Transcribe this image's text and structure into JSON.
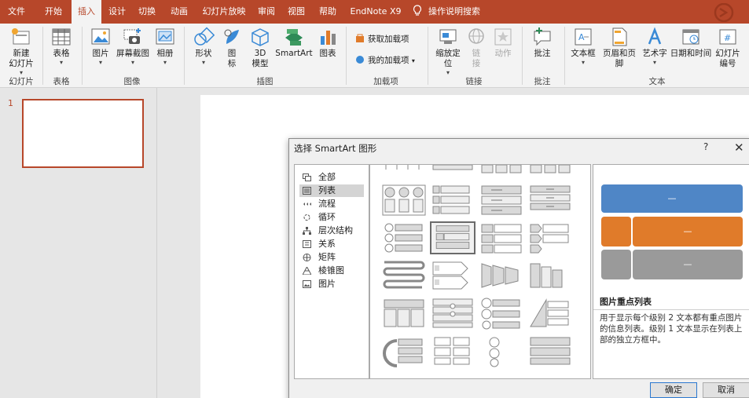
{
  "tabs": [
    "文件",
    "开始",
    "插入",
    "设计",
    "切换",
    "动画",
    "幻灯片放映",
    "审阅",
    "视图",
    "帮助",
    "EndNote X9"
  ],
  "active_tab": "插入",
  "search_label": "操作说明搜索",
  "ribbon": {
    "new_slide": "新建",
    "new_slide_2": "幻灯片",
    "table": "表格",
    "picture": "图片",
    "screenshot": "屏幕截图",
    "album": "相册",
    "shapes": "形状",
    "icons": "图",
    "icons_2": "标",
    "model3d": "3D",
    "model3d_2": "模型",
    "smartart": "SmartArt",
    "chart": "图表",
    "get_addins": "获取加载项",
    "my_addins": "我的加载项",
    "zoom": "缩放定",
    "zoom_2": "位",
    "link": "链",
    "link_2": "接",
    "action": "动作",
    "comment": "批注",
    "textbox": "文本框",
    "header_footer": "页眉和页脚",
    "wordart": "艺术字",
    "datetime": "日期和时间",
    "slide_number": "幻灯片",
    "slide_number_2": "编号"
  },
  "groups": {
    "slides": "幻灯片",
    "tables": "表格",
    "images": "图像",
    "illustrations": "插图",
    "addins": "加载项",
    "links": "链接",
    "comments": "批注",
    "text": "文本"
  },
  "slide_number": "1",
  "dialog": {
    "title": "选择 SmartArt 图形",
    "help": "?",
    "close": "✕",
    "categories": [
      "全部",
      "列表",
      "流程",
      "循环",
      "层次结构",
      "关系",
      "矩阵",
      "棱锥图",
      "图片"
    ],
    "selected_category": "列表",
    "preview_bar_label": "—",
    "preview_title": "图片重点列表",
    "preview_desc": "用于显示每个级别 2 文本都有重点图片的信息列表。级别 1 文本显示在列表上部的独立方框中。",
    "ok": "确定",
    "cancel": "取消"
  },
  "colors": {
    "accent": "#b7472a",
    "blue": "#4f86c6",
    "orange": "#e07b2a",
    "gray": "#9a9a9a"
  }
}
